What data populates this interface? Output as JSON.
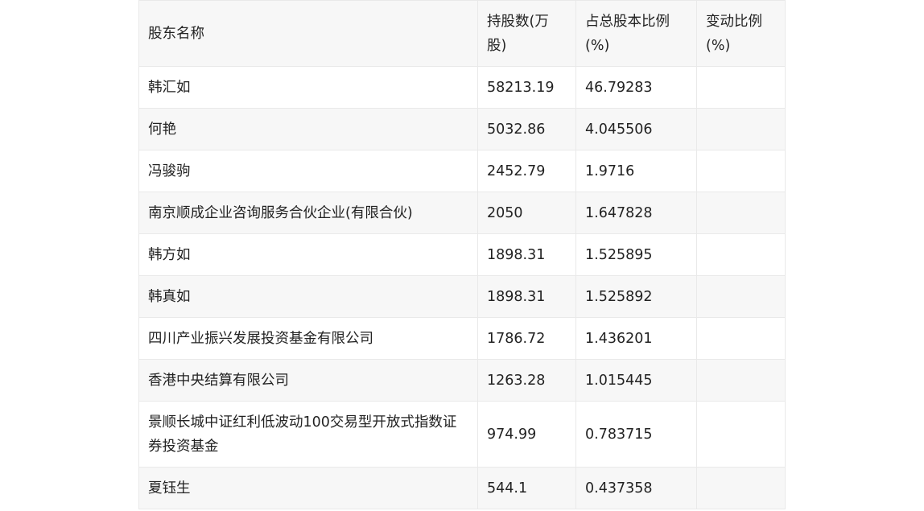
{
  "table": {
    "headers": [
      "股东名称",
      "持股数(万股)",
      "占总股本比例(%)",
      "变动比例(%)"
    ],
    "rows": [
      {
        "name": "韩汇如",
        "shares": "58213.19",
        "ratio": "46.79283",
        "change": ""
      },
      {
        "name": "何艳",
        "shares": "5032.86",
        "ratio": "4.045506",
        "change": ""
      },
      {
        "name": "冯骏驹",
        "shares": "2452.79",
        "ratio": "1.9716",
        "change": ""
      },
      {
        "name": "南京顺成企业咨询服务合伙企业(有限合伙)",
        "shares": "2050",
        "ratio": "1.647828",
        "change": ""
      },
      {
        "name": "韩方如",
        "shares": "1898.31",
        "ratio": "1.525895",
        "change": ""
      },
      {
        "name": "韩真如",
        "shares": "1898.31",
        "ratio": "1.525892",
        "change": ""
      },
      {
        "name": "四川产业振兴发展投资基金有限公司",
        "shares": "1786.72",
        "ratio": "1.436201",
        "change": ""
      },
      {
        "name": "香港中央结算有限公司",
        "shares": "1263.28",
        "ratio": "1.015445",
        "change": ""
      },
      {
        "name": "景顺长城中证红利低波动100交易型开放式指数证券投资基金",
        "shares": "974.99",
        "ratio": "0.783715",
        "change": ""
      },
      {
        "name": "夏钰生",
        "shares": "544.1",
        "ratio": "0.437358",
        "change": ""
      }
    ]
  }
}
